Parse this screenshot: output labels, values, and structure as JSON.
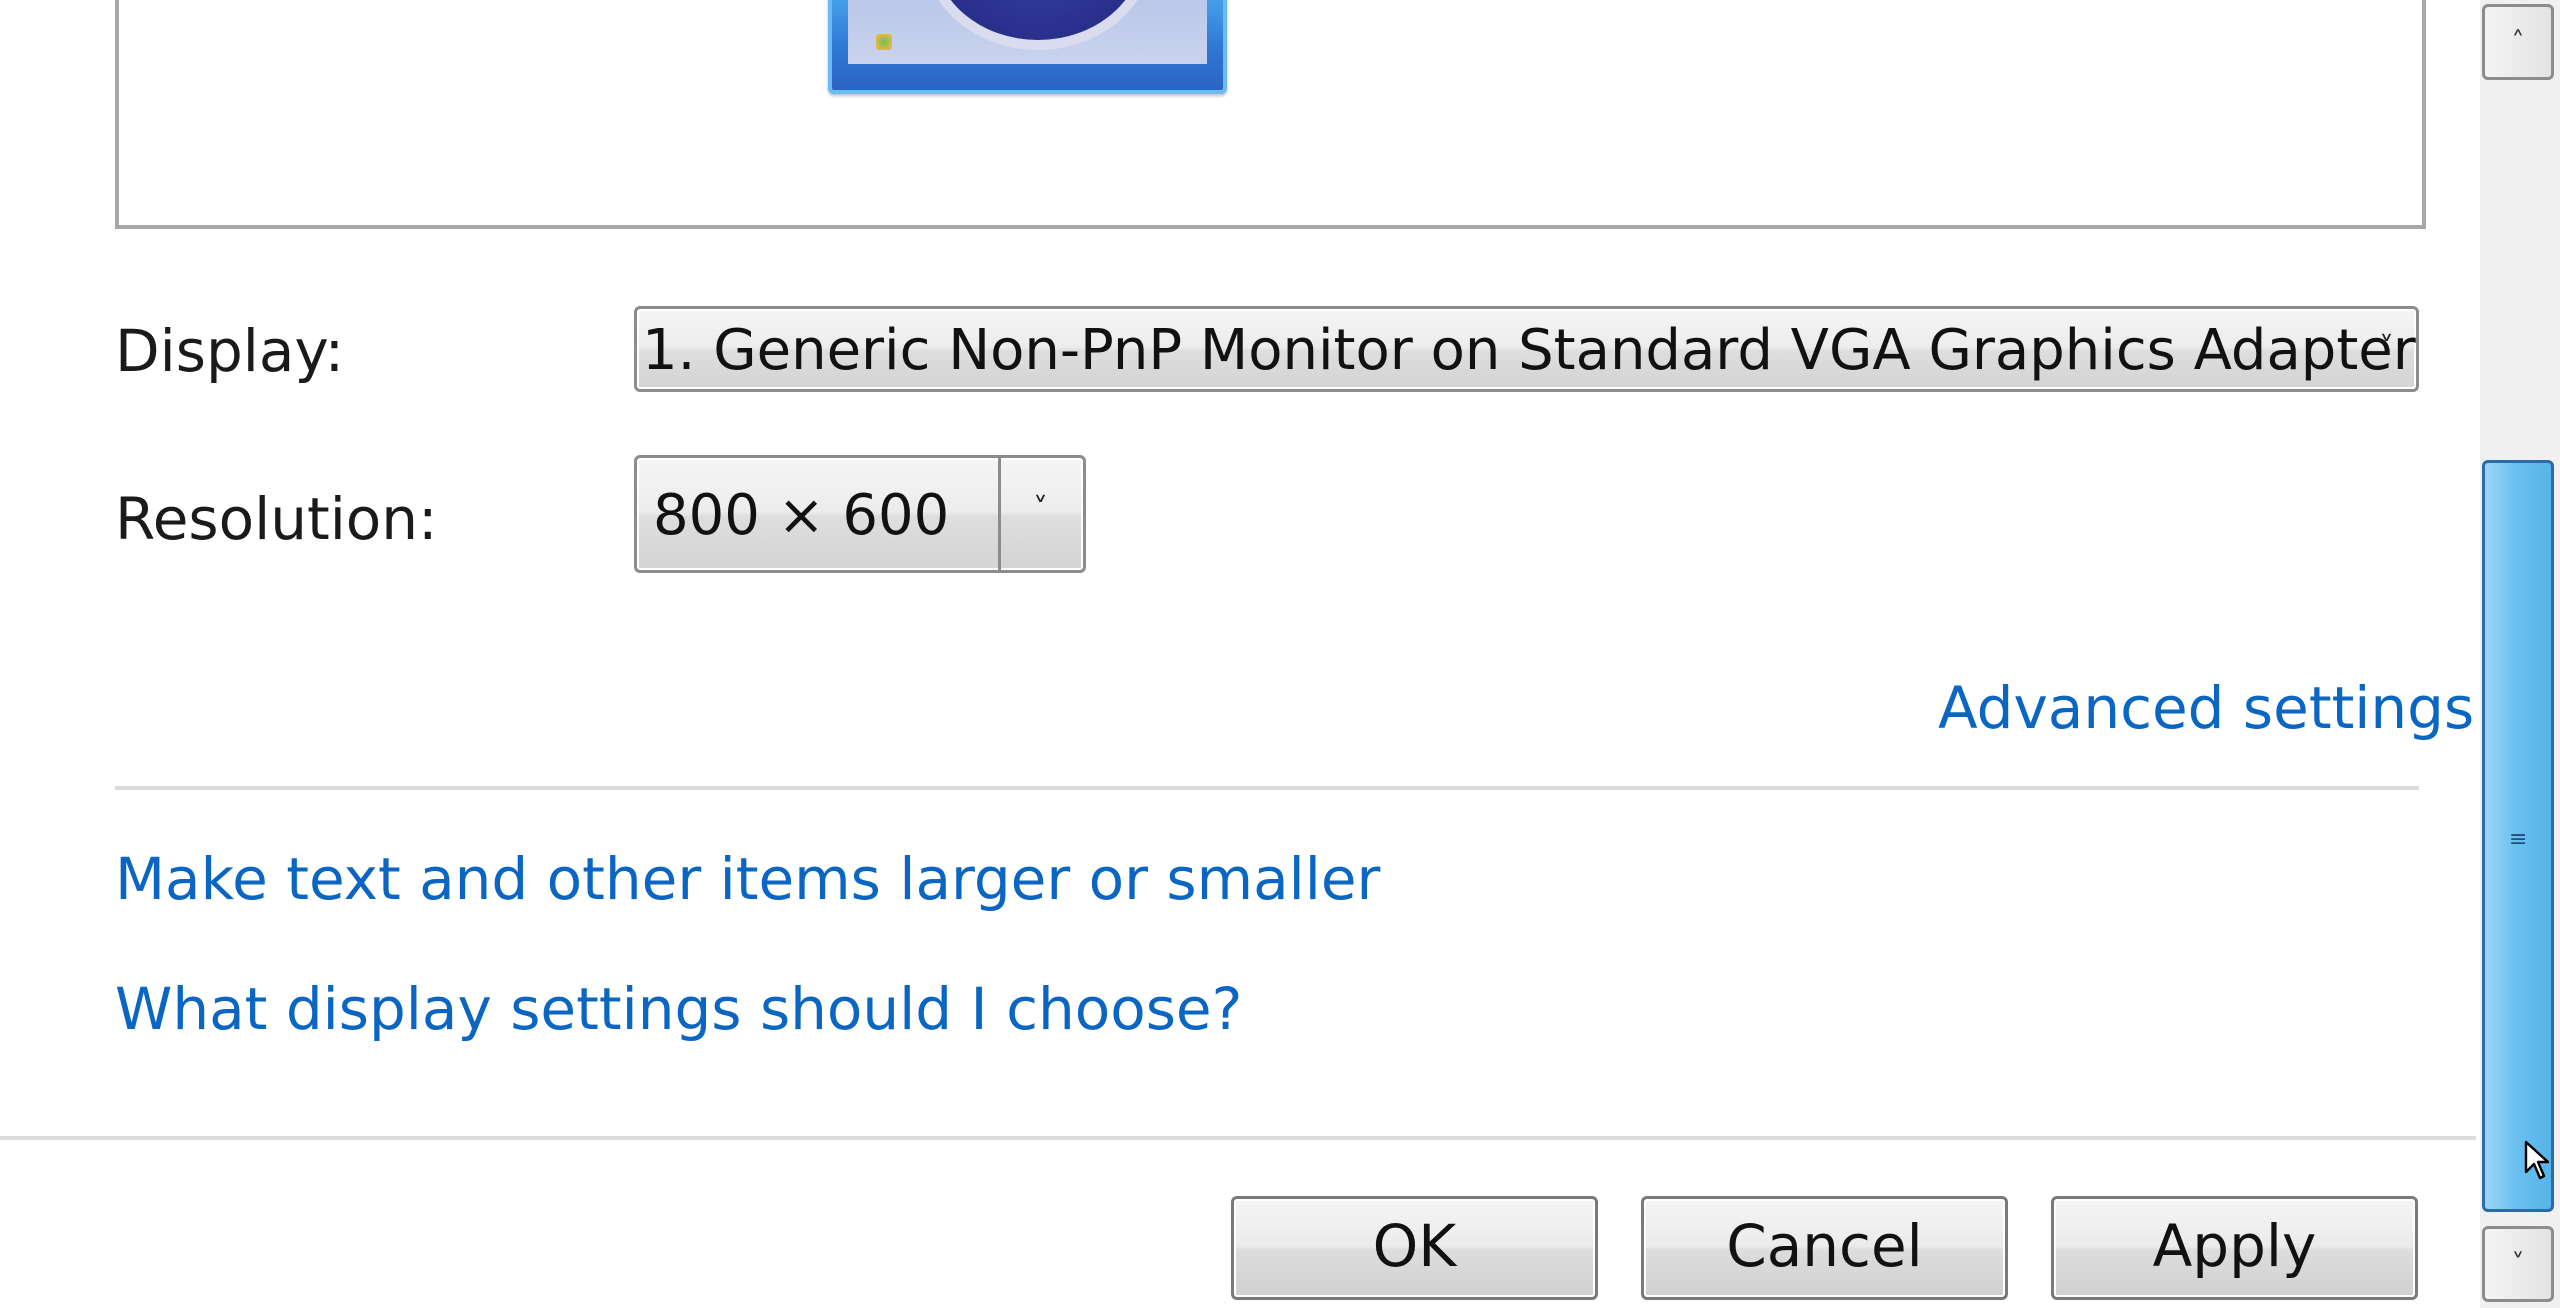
{
  "display": {
    "label": "Display:",
    "selected": "1. Generic Non-PnP Monitor on Standard VGA Graphics Adapter"
  },
  "resolution": {
    "label": "Resolution:",
    "selected": "800 × 600"
  },
  "links": {
    "advanced_settings": "Advanced settings",
    "text_size": "Make text and other items larger or smaller",
    "display_help": "What display settings should I choose?"
  },
  "buttons": {
    "ok": "OK",
    "cancel": "Cancel",
    "apply": "Apply"
  },
  "icons": {
    "dropdown_arrow": "chevron-down-icon",
    "monitor": "monitor-icon",
    "scroll_up": "chevron-up-icon",
    "scroll_down": "chevron-down-icon",
    "cursor": "mouse-pointer-icon"
  },
  "glyphs": {
    "combo_arrow": "˅",
    "scroll_up_arrow": "˄",
    "scroll_down_arrow": "˅",
    "grip": "≡"
  },
  "colors": {
    "link": "#0a66c2",
    "scroll_thumb": "#6cc0ef",
    "separator": "#dcdcdc"
  }
}
